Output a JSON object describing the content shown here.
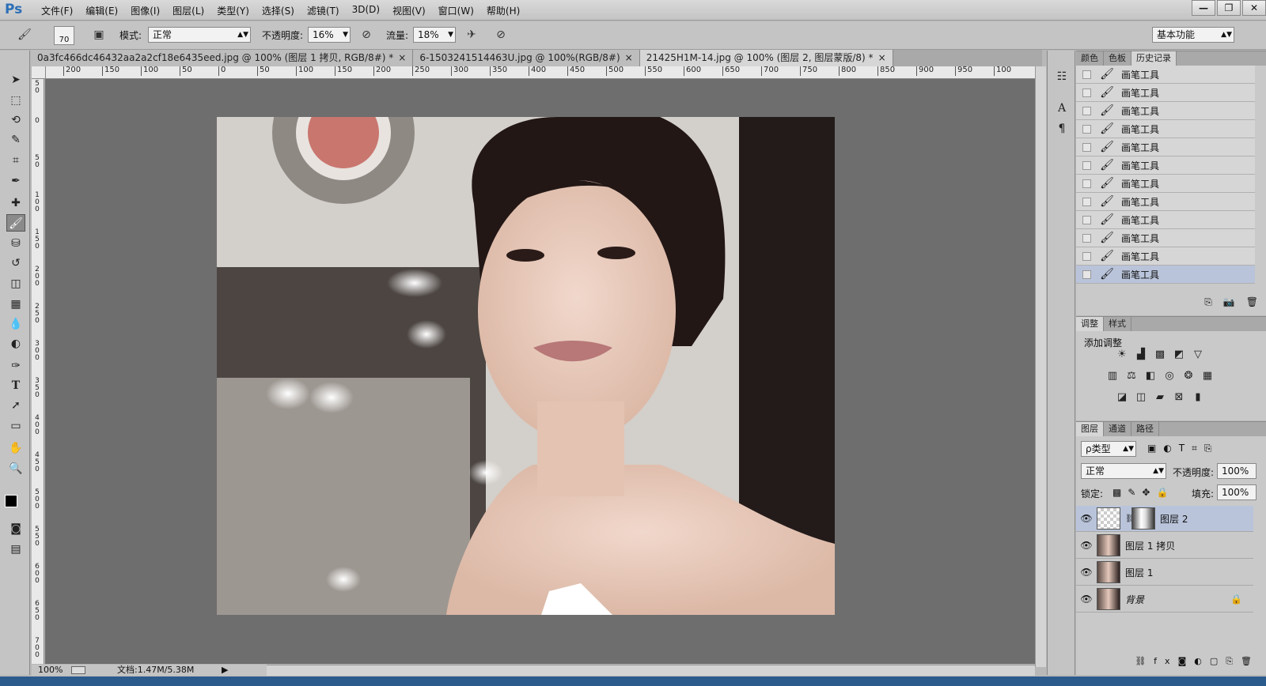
{
  "app": {
    "logo": "Ps",
    "menus": [
      "文件(F)",
      "编辑(E)",
      "图像(I)",
      "图层(L)",
      "类型(Y)",
      "选择(S)",
      "滤镜(T)",
      "3D(D)",
      "视图(V)",
      "窗口(W)",
      "帮助(H)"
    ],
    "window_buttons": [
      "—",
      "❐",
      "✕"
    ]
  },
  "options": {
    "brush_size": "70",
    "mode_label": "模式:",
    "mode_value": "正常",
    "opacity_label": "不透明度:",
    "opacity_value": "16%",
    "flow_label": "流量:",
    "flow_value": "18%",
    "workspace": "基本功能"
  },
  "tabs": [
    {
      "label": "0a3fc466dc46432aa2a2cf18e6435eed.jpg @ 100% (图层 1 拷贝, RGB/8#) *",
      "close": "×"
    },
    {
      "label": "6-1503241514463U.jpg @ 100%(RGB/8#)",
      "close": "×"
    },
    {
      "label": "21425H1M-14.jpg @ 100% (图层 2, 图层蒙版/8) *",
      "close": "×"
    }
  ],
  "ruler_h": [
    "200",
    "150",
    "100",
    "50",
    "0",
    "50",
    "100",
    "150",
    "200",
    "250",
    "300",
    "350",
    "400",
    "450",
    "500",
    "550",
    "600",
    "650",
    "700",
    "750",
    "800",
    "850",
    "900",
    "950",
    "100"
  ],
  "ruler_v": [
    "5\n0",
    "0",
    "5\n0",
    "1\n0\n0",
    "1\n5\n0",
    "2\n0\n0",
    "2\n5\n0",
    "3\n0\n0",
    "3\n5\n0",
    "4\n0\n0",
    "4\n5\n0",
    "5\n0\n0",
    "5\n5\n0",
    "6\n0\n0",
    "6\n5\n0",
    "7\n0\n0"
  ],
  "status": {
    "zoom": "100%",
    "doc": "文档:1.47M/5.38M"
  },
  "history": {
    "tabs": [
      "颜色",
      "色板",
      "历史记录"
    ],
    "items": [
      "画笔工具",
      "画笔工具",
      "画笔工具",
      "画笔工具",
      "画笔工具",
      "画笔工具",
      "画笔工具",
      "画笔工具",
      "画笔工具",
      "画笔工具",
      "画笔工具",
      "画笔工具"
    ]
  },
  "adjust": {
    "tabs": [
      "调整",
      "样式"
    ],
    "title": "添加调整"
  },
  "layers": {
    "tabs": [
      "图层",
      "通道",
      "路径"
    ],
    "filter": "ρ类型",
    "blend": "正常",
    "opacity_label": "不透明度:",
    "opacity": "100%",
    "lock_label": "锁定:",
    "fill_label": "填充:",
    "fill": "100%",
    "items": [
      {
        "name": "图层 2",
        "selected": true
      },
      {
        "name": "图层 1 拷贝",
        "selected": false
      },
      {
        "name": "图层 1",
        "selected": false
      },
      {
        "name": "背景",
        "selected": false
      }
    ]
  }
}
